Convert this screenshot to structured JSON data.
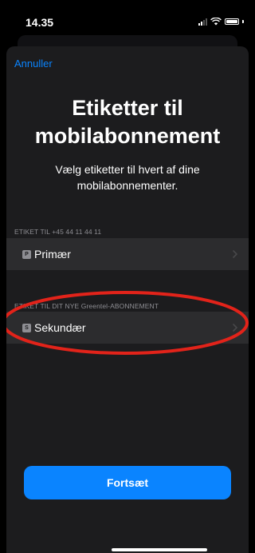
{
  "status_bar": {
    "time": "14.35"
  },
  "sheet": {
    "cancel_label": "Annuller",
    "title": "Etiketter til mobilabonnement",
    "subtitle": "Vælg etiketter til hvert af dine mobilabonnementer.",
    "sections": [
      {
        "header": "ETIKET TIL +45 44 11 44 11",
        "badge": "P",
        "label": "Primær"
      },
      {
        "header": "ETIKET TIL DIT NYE Greentel-ABONNEMENT",
        "badge": "S",
        "label": "Sekundær"
      }
    ],
    "continue_label": "Fortsæt"
  },
  "colors": {
    "accent": "#0a84ff",
    "annotation": "#e2231a"
  },
  "icons": [
    "signal-icon",
    "wifi-icon",
    "battery-icon",
    "chevron-right-icon"
  ]
}
